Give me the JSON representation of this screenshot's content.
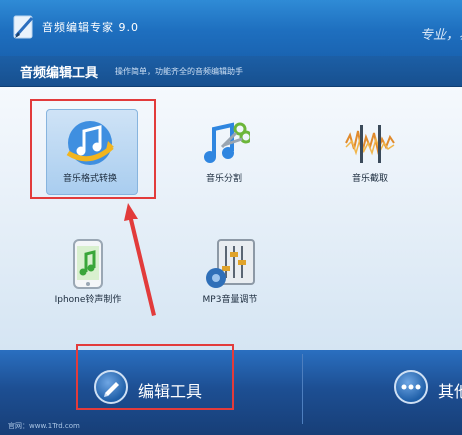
{
  "window": {
    "title": "音频编辑专家 9.0",
    "slogan": "专业，易"
  },
  "header": {
    "section_title": "音频编辑工具",
    "section_desc": "操作简单，功能齐全的音频编辑助手"
  },
  "tools": [
    {
      "label": "音乐格式转换",
      "icon": "music-convert-icon",
      "selected": true
    },
    {
      "label": "音乐分割",
      "icon": "music-split-icon"
    },
    {
      "label": "音乐截取",
      "icon": "music-cut-icon"
    },
    {
      "label": "Iphone铃声制作",
      "icon": "iphone-ringtone-icon"
    },
    {
      "label": "MP3音量调节",
      "icon": "mp3-volume-icon"
    }
  ],
  "bottom_nav": {
    "edit_label": "编辑工具",
    "other_label": "其他"
  },
  "footer": {
    "url": "官网：www.1Trd.com"
  },
  "colors": {
    "accent": "#1e6fbf",
    "highlight": "#e23b3b"
  }
}
